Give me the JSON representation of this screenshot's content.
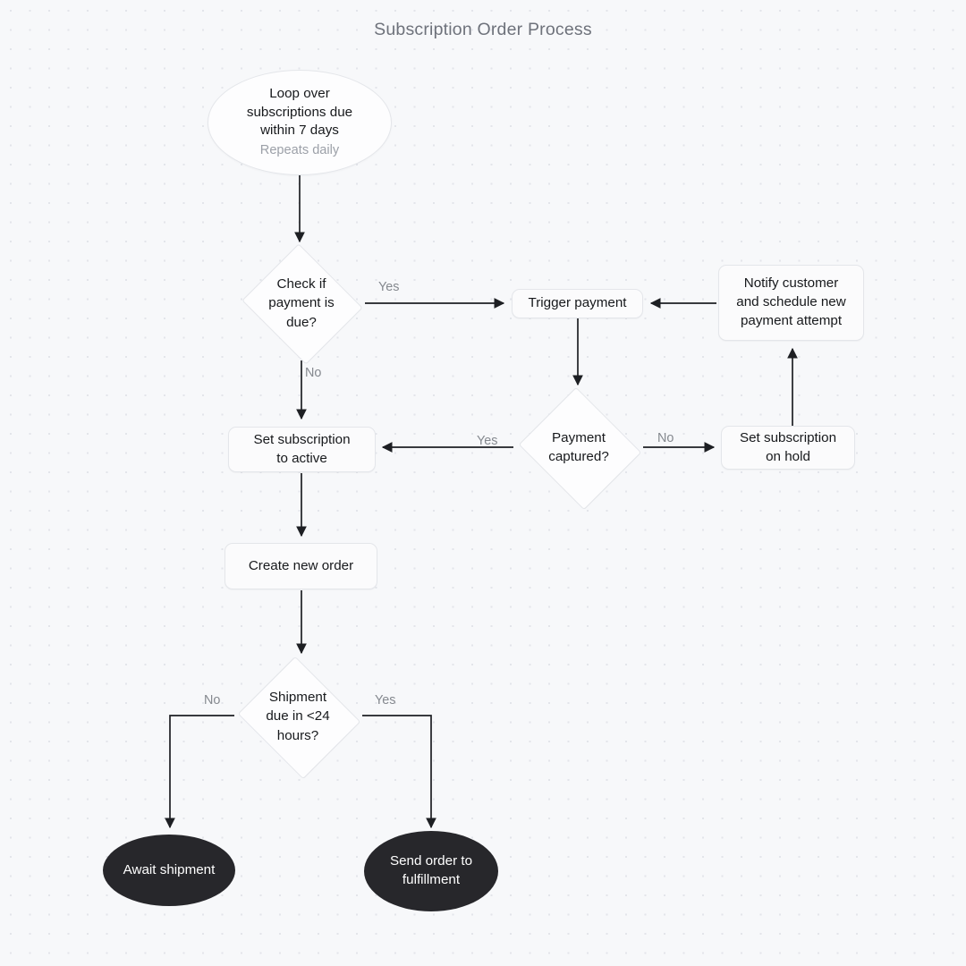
{
  "diagram": {
    "title": "Subscription Order Process",
    "type": "flowchart",
    "background_color": "#f7f8fa",
    "accent_color": "#27272b",
    "nodes": [
      {
        "id": "start",
        "shape": "ellipse",
        "label": "Loop over subscriptions due within 7 days",
        "sublabel": "Repeats daily"
      },
      {
        "id": "check_payment_due",
        "shape": "diamond",
        "label": "Check if payment is due?"
      },
      {
        "id": "trigger_payment",
        "shape": "process",
        "label": "Trigger payment"
      },
      {
        "id": "notify_customer",
        "shape": "process",
        "label": "Notify customer and schedule new payment attempt"
      },
      {
        "id": "payment_captured",
        "shape": "diamond",
        "label": "Payment captured?"
      },
      {
        "id": "set_on_hold",
        "shape": "process",
        "label": "Set subscription on hold"
      },
      {
        "id": "set_active",
        "shape": "process",
        "label": "Set subscription to active"
      },
      {
        "id": "create_order",
        "shape": "process",
        "label": "Create new order"
      },
      {
        "id": "shipment_due",
        "shape": "diamond",
        "label": "Shipment due in <24 hours?"
      },
      {
        "id": "await_shipment",
        "shape": "ellipse-filled",
        "label": "Await shipment"
      },
      {
        "id": "send_fulfillment",
        "shape": "ellipse-filled",
        "label": "Send order to fulfillment"
      }
    ],
    "edges": [
      {
        "from": "start",
        "to": "check_payment_due",
        "label": ""
      },
      {
        "from": "check_payment_due",
        "to": "trigger_payment",
        "label": "Yes"
      },
      {
        "from": "check_payment_due",
        "to": "set_active",
        "label": "No"
      },
      {
        "from": "trigger_payment",
        "to": "payment_captured",
        "label": ""
      },
      {
        "from": "payment_captured",
        "to": "set_active",
        "label": "Yes"
      },
      {
        "from": "payment_captured",
        "to": "set_on_hold",
        "label": "No"
      },
      {
        "from": "set_on_hold",
        "to": "notify_customer",
        "label": ""
      },
      {
        "from": "notify_customer",
        "to": "trigger_payment",
        "label": ""
      },
      {
        "from": "set_active",
        "to": "create_order",
        "label": ""
      },
      {
        "from": "create_order",
        "to": "shipment_due",
        "label": ""
      },
      {
        "from": "shipment_due",
        "to": "await_shipment",
        "label": "No"
      },
      {
        "from": "shipment_due",
        "to": "send_fulfillment",
        "label": "Yes"
      }
    ],
    "labels": {
      "start_main_line1": "Loop over",
      "start_main_line2": "subscriptions due",
      "start_main_line3": "within 7 days",
      "start_sub": "Repeats daily",
      "check_line1": "Check if",
      "check_line2": "payment is",
      "check_line3": "due?",
      "trigger_payment": "Trigger payment",
      "notify_line1": "Notify customer",
      "notify_line2": "and schedule new",
      "notify_line3": "payment attempt",
      "captured_line1": "Payment",
      "captured_line2": "captured?",
      "on_hold_line1": "Set subscription",
      "on_hold_line2": "on hold",
      "active_line1": "Set subscription",
      "active_line2": "to active",
      "create_order": "Create new order",
      "shipment_line1": "Shipment",
      "shipment_line2": "due in <24",
      "shipment_line3": "hours?",
      "await_shipment": "Await shipment",
      "fulfillment_line1": "Send order to",
      "fulfillment_line2": "fulfillment",
      "edge_yes_1": "Yes",
      "edge_no_1": "No",
      "edge_yes_2": "Yes",
      "edge_no_2": "No",
      "edge_no_3": "No",
      "edge_yes_3": "Yes"
    }
  }
}
